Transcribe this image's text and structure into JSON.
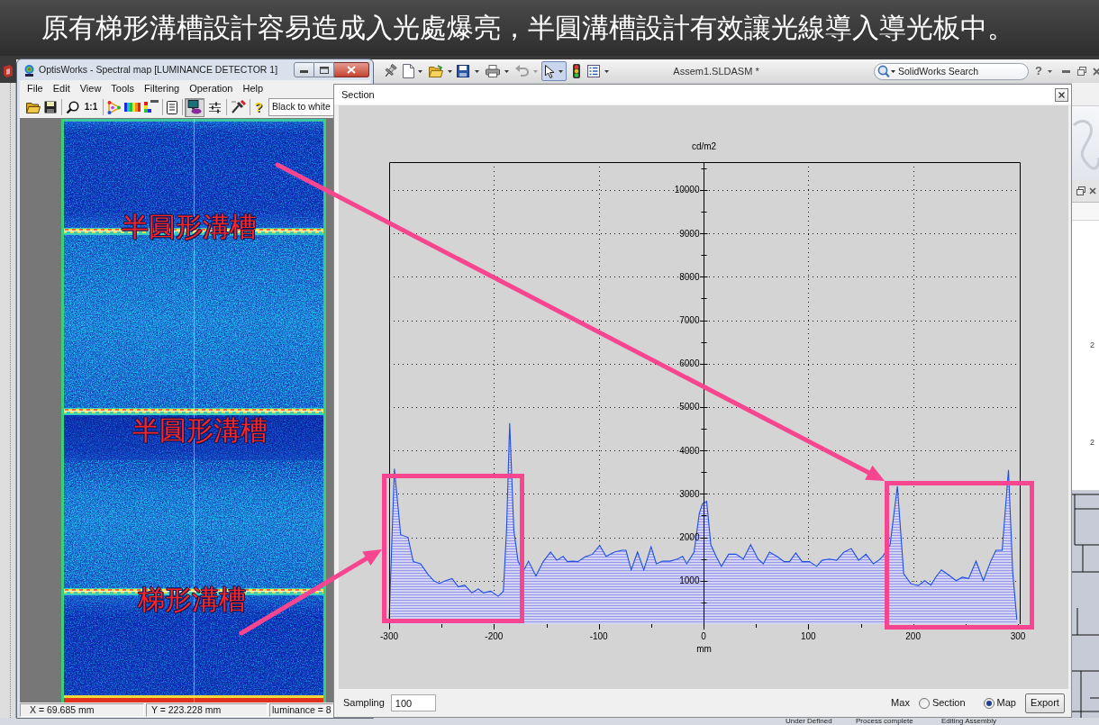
{
  "slide_title": "原有梯形溝槽設計容易造成入光處爆亮，半圓溝槽設計有效讓光線導入導光板中。",
  "solidworks": {
    "toolbar": {
      "select_tool_pressed": true,
      "document_title": "Assem1.SLDASM *",
      "search": {
        "placeholder": "SolidWorks Search"
      },
      "help": "?"
    },
    "side_panel_labels": [
      "2",
      "2"
    ],
    "status_bar": [
      "Under Defined",
      "Process complete",
      "Editing Assembly"
    ]
  },
  "optis_window": {
    "title": "OptisWorks - Spectral map [LUMINANCE DETECTOR 1]",
    "menu": [
      "File",
      "Edit",
      "View",
      "Tools",
      "Filtering",
      "Operation",
      "Help"
    ],
    "toolbar": {
      "zoom_ratio": "1:1",
      "map_view_pressed": true,
      "help": "?",
      "palette": "Black to white"
    },
    "map_labels": [
      "半圓形溝槽",
      "半圓形溝槽",
      "梯形溝槽"
    ],
    "status_bar": [
      "X = 69.685 mm",
      "Y = 223.228 mm",
      "luminance = 8"
    ]
  },
  "section_window": {
    "title": "Section",
    "chart_data": {
      "type": "area",
      "xlabel": "mm",
      "ylabel": "cd/m2",
      "x": [
        -300,
        -295,
        -289,
        -282,
        -277,
        -270,
        -263,
        -257,
        -252,
        -246,
        -240,
        -234,
        -228,
        -221,
        -215,
        -210,
        -203,
        -196,
        -191,
        -188,
        -185,
        -181,
        -177,
        -172,
        -167,
        -160,
        -153,
        -146,
        -140,
        -134,
        -130,
        -125,
        -120,
        -113,
        -106,
        -99,
        -93,
        -85,
        -78,
        -74,
        -69,
        -63,
        -57,
        -50,
        -45,
        -39,
        -32,
        -25,
        -20,
        -16,
        -9,
        -4,
        -1,
        3,
        7,
        12,
        17,
        24,
        31,
        38,
        45,
        52,
        57,
        63,
        70,
        77,
        82,
        88,
        94,
        101,
        108,
        113,
        120,
        127,
        134,
        141,
        148,
        155,
        162,
        167,
        171,
        178,
        185,
        191,
        198,
        205,
        211,
        217,
        222,
        227,
        234,
        241,
        247,
        253,
        260,
        267,
        274,
        279,
        285,
        291,
        295,
        299
      ],
      "series": [
        {
          "color": "#1f4fe6",
          "values": [
            100,
            3580,
            2060,
            2000,
            1440,
            1390,
            1150,
            990,
            940,
            1000,
            1050,
            860,
            900,
            720,
            810,
            720,
            760,
            640,
            760,
            2160,
            4630,
            2160,
            1450,
            1220,
            1450,
            1110,
            1440,
            1660,
            1470,
            1560,
            1440,
            1450,
            1440,
            1550,
            1610,
            1810,
            1560,
            1660,
            1700,
            1700,
            1250,
            1660,
            1250,
            1780,
            1390,
            1450,
            1450,
            1500,
            1560,
            1390,
            1660,
            2550,
            2770,
            2830,
            1830,
            1560,
            1330,
            1610,
            1610,
            1500,
            1830,
            1500,
            1390,
            1660,
            1560,
            1440,
            1440,
            1640,
            1440,
            1440,
            1330,
            1470,
            1500,
            1470,
            1660,
            1740,
            1470,
            1610,
            1390,
            1470,
            1560,
            1830,
            3180,
            1160,
            930,
            890,
            1000,
            900,
            1100,
            1250,
            1130,
            1000,
            1080,
            1050,
            1450,
            1000,
            1450,
            1700,
            1700,
            3550,
            1200,
            100
          ]
        }
      ],
      "xlim": [
        -300,
        300
      ],
      "ylim": [
        0,
        10640
      ],
      "xticks": [
        -300,
        -200,
        -100,
        0,
        100,
        200,
        300
      ],
      "yticks": [
        1000,
        2000,
        3000,
        4000,
        5000,
        6000,
        7000,
        8000,
        9000,
        10000
      ],
      "grid": true
    },
    "sampling": {
      "label": "Sampling",
      "value": "100"
    },
    "max_label": "Max",
    "modes": [
      {
        "label": "Section",
        "selected": false
      },
      {
        "label": "Map",
        "selected": true
      }
    ],
    "export_button": "Export"
  }
}
